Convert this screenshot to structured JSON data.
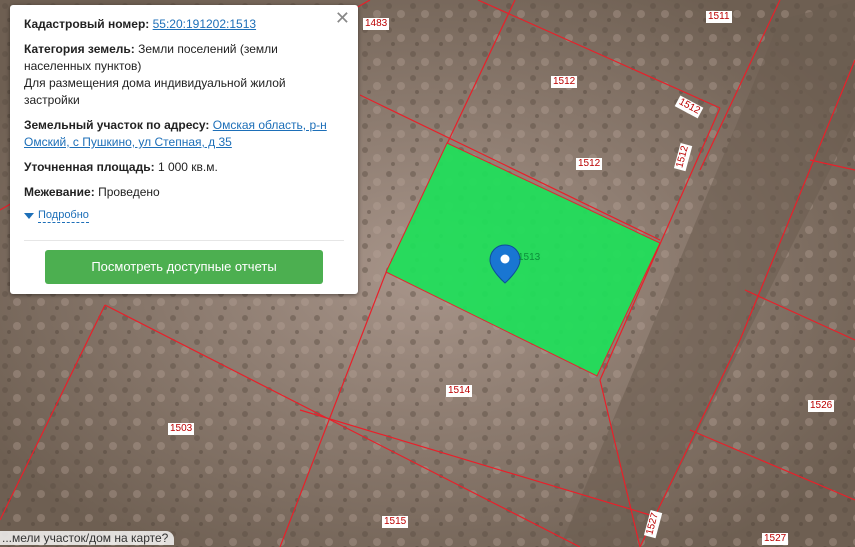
{
  "popup": {
    "cadastral_label": "Кадастровый номер:",
    "cadastral_value": "55:20:191202:1513",
    "category_label": "Категория земель:",
    "category_value": "Земли поселений (земли населенных пунктов)",
    "usage": "Для размещения дома индивидуальной жилой застройки",
    "address_label": "Земельный участок по адресу:",
    "address_value": "Омская область, р-н Омский, с Пушкино, ул Степная, д 35",
    "area_label": "Уточненная площадь:",
    "area_value": "1 000 кв.м.",
    "survey_label": "Межевание:",
    "survey_value": "Проведено",
    "more_link": "Подробно",
    "reports_button": "Посмотреть доступные отчеты",
    "close_icon": "close-icon"
  },
  "map": {
    "parcel_labels": [
      "1483",
      "1511",
      "1512",
      "1512",
      "1512",
      "1512",
      "1513",
      "1514",
      "1503",
      "1526",
      "1515",
      "1527",
      "1527"
    ],
    "selected_parcel_color": "#1fe05a",
    "boundary_color": "#e8202a"
  },
  "bottom_hint": "...мели участок/дом на карте?"
}
